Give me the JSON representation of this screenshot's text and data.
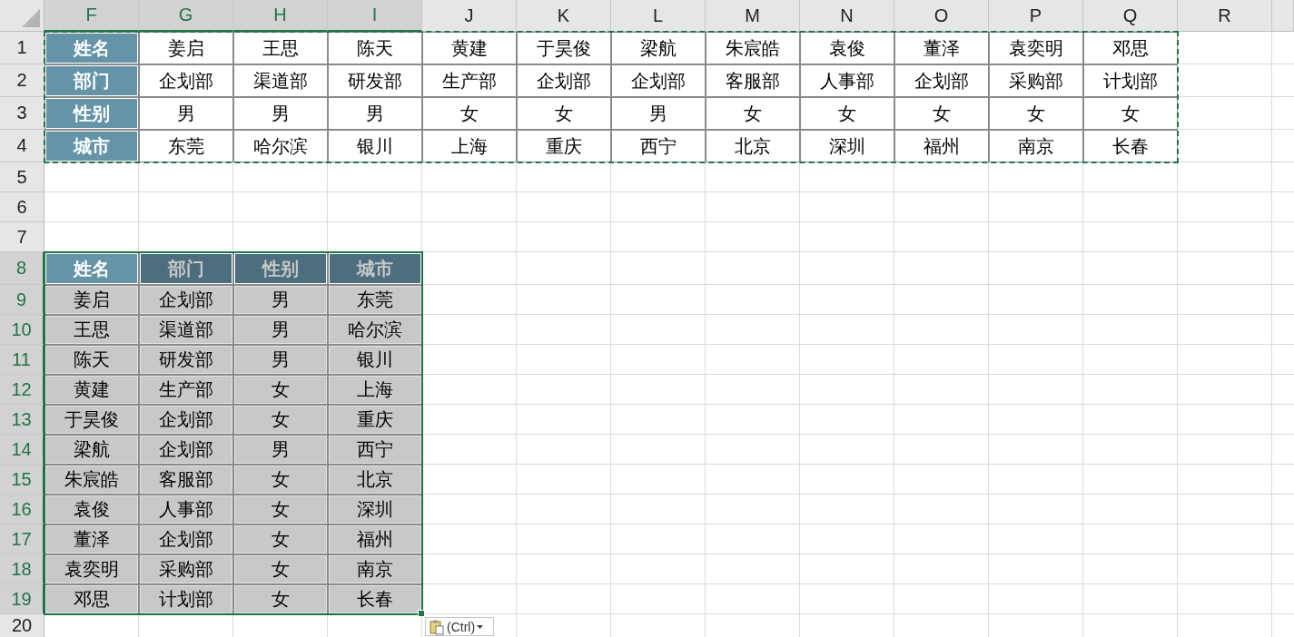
{
  "columns": [
    {
      "label": "F",
      "selected": true
    },
    {
      "label": "G",
      "selected": true
    },
    {
      "label": "H",
      "selected": true
    },
    {
      "label": "I",
      "selected": true
    },
    {
      "label": "J",
      "selected": false
    },
    {
      "label": "K",
      "selected": false
    },
    {
      "label": "L",
      "selected": false
    },
    {
      "label": "M",
      "selected": false
    },
    {
      "label": "N",
      "selected": false
    },
    {
      "label": "O",
      "selected": false
    },
    {
      "label": "P",
      "selected": false
    },
    {
      "label": "Q",
      "selected": false
    },
    {
      "label": "R",
      "selected": false
    }
  ],
  "rows": [
    {
      "label": "1",
      "selected": false
    },
    {
      "label": "2",
      "selected": false
    },
    {
      "label": "3",
      "selected": false
    },
    {
      "label": "4",
      "selected": false
    },
    {
      "label": "5",
      "selected": false
    },
    {
      "label": "6",
      "selected": false
    },
    {
      "label": "7",
      "selected": false
    },
    {
      "label": "8",
      "selected": true
    },
    {
      "label": "9",
      "selected": true
    },
    {
      "label": "10",
      "selected": true
    },
    {
      "label": "11",
      "selected": true
    },
    {
      "label": "12",
      "selected": true
    },
    {
      "label": "13",
      "selected": true
    },
    {
      "label": "14",
      "selected": true
    },
    {
      "label": "15",
      "selected": true
    },
    {
      "label": "16",
      "selected": true
    },
    {
      "label": "17",
      "selected": true
    },
    {
      "label": "18",
      "selected": true
    },
    {
      "label": "19",
      "selected": true
    },
    {
      "label": "20",
      "selected": false
    }
  ],
  "top_table": [
    {
      "header": "姓名",
      "cells": [
        "姜启",
        "王思",
        "陈天",
        "黄建",
        "于昊俊",
        "梁航",
        "朱宸皓",
        "袁俊",
        "董泽",
        "袁奕明",
        "邓思"
      ]
    },
    {
      "header": "部门",
      "cells": [
        "企划部",
        "渠道部",
        "研发部",
        "生产部",
        "企划部",
        "企划部",
        "客服部",
        "人事部",
        "企划部",
        "采购部",
        "计划部"
      ]
    },
    {
      "header": "性别",
      "cells": [
        "男",
        "男",
        "男",
        "女",
        "女",
        "男",
        "女",
        "女",
        "女",
        "女",
        "女"
      ]
    },
    {
      "header": "城市",
      "cells": [
        "东莞",
        "哈尔滨",
        "银川",
        "上海",
        "重庆",
        "西宁",
        "北京",
        "深圳",
        "福州",
        "南京",
        "长春"
      ]
    }
  ],
  "bottom_table": {
    "header": [
      {
        "text": "姓名",
        "active": true
      },
      {
        "text": "部门",
        "active": false
      },
      {
        "text": "性别",
        "active": false
      },
      {
        "text": "城市",
        "active": false
      }
    ],
    "rows": [
      [
        "姜启",
        "企划部",
        "男",
        "东莞"
      ],
      [
        "王思",
        "渠道部",
        "男",
        "哈尔滨"
      ],
      [
        "陈天",
        "研发部",
        "男",
        "银川"
      ],
      [
        "黄建",
        "生产部",
        "女",
        "上海"
      ],
      [
        "于昊俊",
        "企划部",
        "女",
        "重庆"
      ],
      [
        "梁航",
        "企划部",
        "男",
        "西宁"
      ],
      [
        "朱宸皓",
        "客服部",
        "女",
        "北京"
      ],
      [
        "袁俊",
        "人事部",
        "女",
        "深圳"
      ],
      [
        "董泽",
        "企划部",
        "女",
        "福州"
      ],
      [
        "袁奕明",
        "采购部",
        "女",
        "南京"
      ],
      [
        "邓思",
        "计划部",
        "女",
        "长春"
      ]
    ]
  },
  "paste_options": {
    "label": "(Ctrl)"
  }
}
